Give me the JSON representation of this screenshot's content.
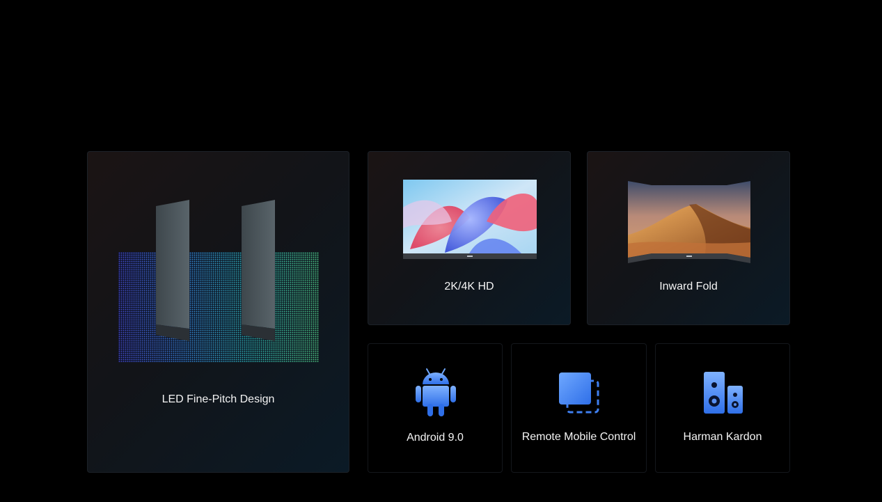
{
  "features": {
    "led": {
      "label": "LED Fine-Pitch Design",
      "icon": "led-panel-icon"
    },
    "hd": {
      "label": "2K/4K HD",
      "icon": "tv-screen-icon"
    },
    "fold": {
      "label": "Inward Fold",
      "icon": "curved-screen-icon"
    },
    "android": {
      "label": "Android 9.0",
      "icon": "android-icon"
    },
    "remote": {
      "label": "Remote Mobile Control",
      "icon": "screen-cast-icon"
    },
    "audio": {
      "label": "Harman Kardon",
      "icon": "speaker-icon"
    }
  },
  "colors": {
    "background": "#000000",
    "icon_blue_light": "#6fa8ff",
    "icon_blue_dark": "#2f6fe8",
    "led_left": "#4a5cf0",
    "led_right": "#3fd6a0"
  }
}
